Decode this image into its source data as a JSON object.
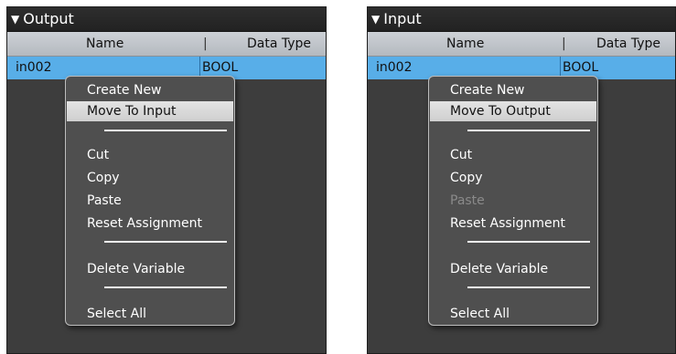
{
  "panels": [
    {
      "title": "Output",
      "columns": {
        "name": "Name",
        "separator": "|",
        "type": "Data Type"
      },
      "row": {
        "name": "in002",
        "type": "BOOL"
      },
      "menu": {
        "create_new": "Create New",
        "move_to": "Move To Input",
        "cut": "Cut",
        "copy": "Copy",
        "paste": "Paste",
        "reset_assignment": "Reset Assignment",
        "delete_variable": "Delete Variable",
        "select_all": "Select All"
      }
    },
    {
      "title": "Input",
      "columns": {
        "name": "Name",
        "separator": "|",
        "type": "Data Type"
      },
      "row": {
        "name": "in002",
        "type": "BOOL"
      },
      "menu": {
        "create_new": "Create New",
        "move_to": "Move To Output",
        "cut": "Cut",
        "copy": "Copy",
        "paste": "Paste",
        "reset_assignment": "Reset Assignment",
        "delete_variable": "Delete Variable",
        "select_all": "Select All"
      }
    }
  ],
  "icons": {
    "collapse": "triangle-down-icon"
  },
  "colors": {
    "panel_bg": "#3d3d3d",
    "header_bg": "#262626",
    "selected_row": "#58aee8",
    "menu_bg": "#4f4f4f",
    "menu_highlight": "#d9d9d9",
    "disabled_text": "#8a8a8a"
  }
}
